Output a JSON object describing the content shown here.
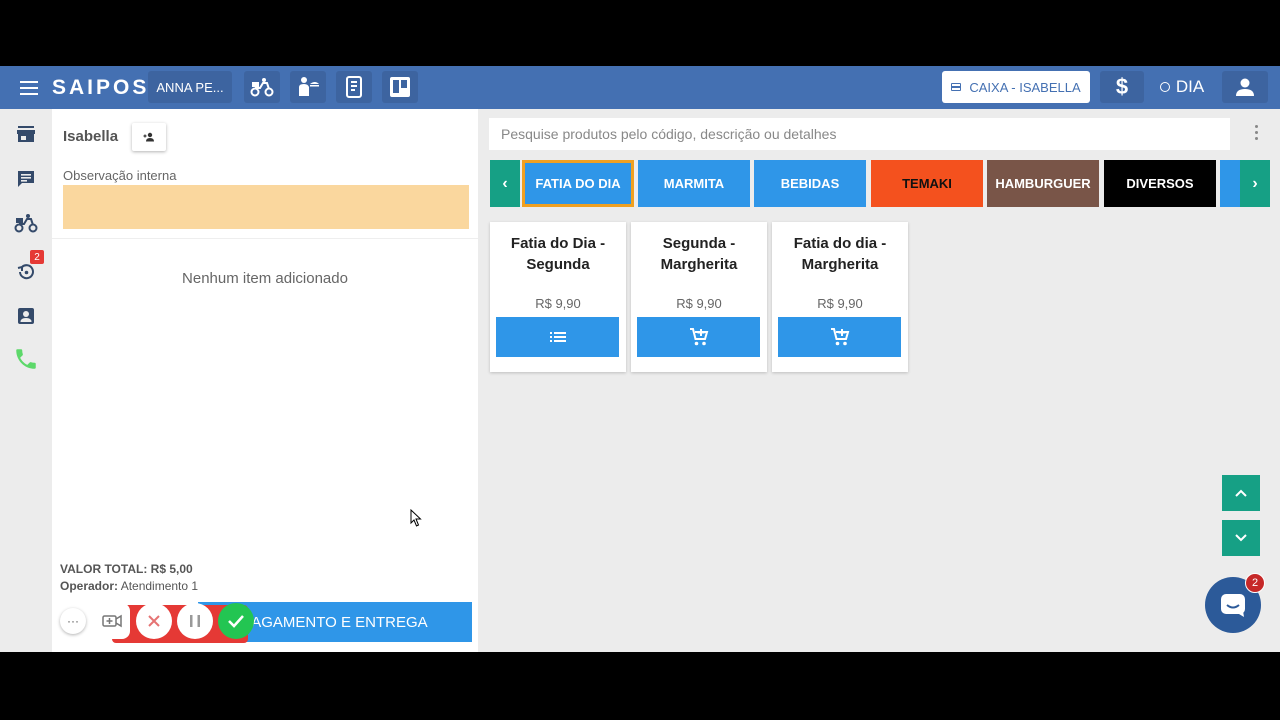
{
  "topbar": {
    "logo": "SAIPOS",
    "store_name": "ANNA PE...",
    "caixa_label": "CAIXA - ISABELLA",
    "currency_symbol": "$",
    "period_label": "DIA"
  },
  "sidebar": {
    "history_badge": "2"
  },
  "order": {
    "customer_name": "Isabella",
    "obs_label": "Observação interna",
    "obs_value": "",
    "empty_message": "Nenhum item adicionado",
    "total_label": "VALOR TOTAL: R$ 5,00",
    "operator_label": "Operador:",
    "operator_name": "Atendimento 1",
    "pay_button": "PAGAMENTO E ENTREGA"
  },
  "call": {
    "dots": "···"
  },
  "main": {
    "search_placeholder": "Pesquise produtos pelo código, descrição ou detalhes",
    "categories": [
      {
        "label": "FATIA DO DIA",
        "color": "#2f96e8",
        "selected": true
      },
      {
        "label": "MARMITA",
        "color": "#2f96e8"
      },
      {
        "label": "BEBIDAS",
        "color": "#2f96e8"
      },
      {
        "label": "TEMAKI",
        "color": "#f4511e",
        "text_color": "#111111"
      },
      {
        "label": "HAMBURGUER",
        "color": "#795548"
      },
      {
        "label": "DIVERSOS",
        "color": "#000000"
      }
    ],
    "products": [
      {
        "name": "Fatia do Dia - Segunda",
        "price": "R$ 9,90",
        "action_icon": "list-icon"
      },
      {
        "name": "Segunda - Margherita",
        "price": "R$ 9,90",
        "action_icon": "cart-add-icon"
      },
      {
        "name": "Fatia do dia - Margherita",
        "price": "R$ 9,90",
        "action_icon": "cart-add-icon"
      }
    ],
    "chat_badge": "2"
  },
  "colors": {
    "topbar": "#4470b2",
    "primary": "#2f96e8",
    "teal": "#16a085",
    "obs_field": "#fad79e",
    "selected_outline": "#f0a020"
  }
}
